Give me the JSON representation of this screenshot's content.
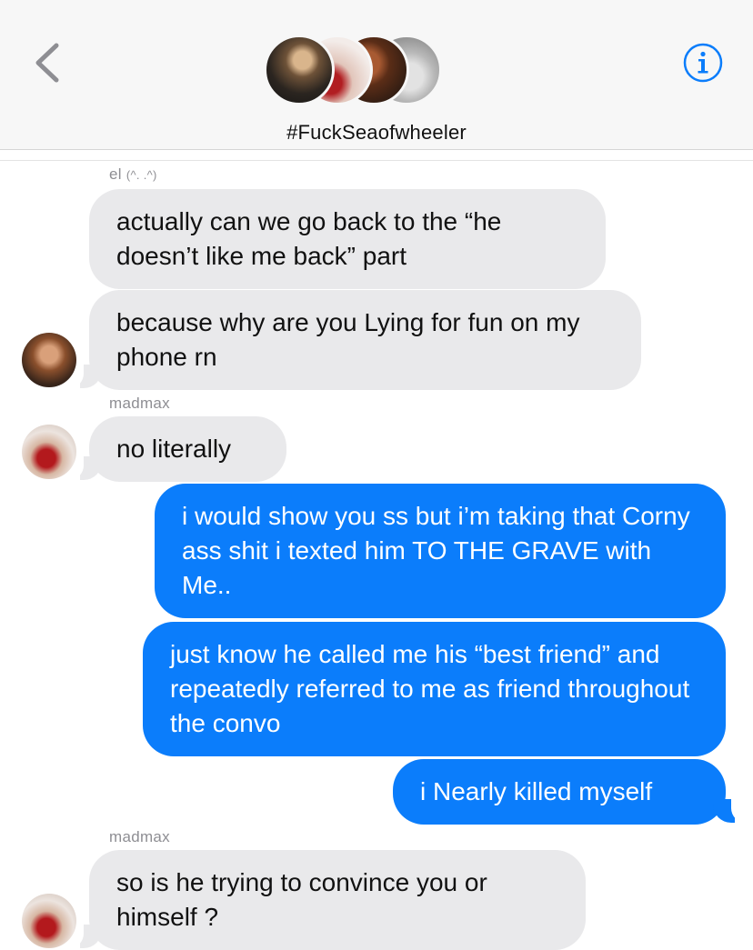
{
  "header": {
    "group_title": "#FuckSeaofwheeler",
    "back_icon": "chevron-left-icon",
    "info_icon": "info-icon",
    "accent_color": "#0b7dfb"
  },
  "messages": [
    {
      "sender": "el",
      "sender_emoticon": "(^. .^)",
      "text": "actually can we go back to the “he doesn’t like me back” part"
    },
    {
      "text": "because why are you Lying for fun on my phone rn"
    },
    {
      "sender": "madmax",
      "text": "no literally"
    },
    {
      "text": "i would show you ss but i’m taking that Corny ass shit i texted him TO THE GRAVE with Me.."
    },
    {
      "text": "just know he called me his “best friend” and repeatedly referred to me as friend throughout the convo"
    },
    {
      "text": "i Nearly killed myself"
    },
    {
      "sender": "madmax",
      "text": "so is he trying to convince you or himself ?"
    }
  ],
  "colors": {
    "incoming_bubble": "#e9e9eb",
    "outgoing_bubble": "#0b7dfb",
    "sender_label": "#8e8e93"
  }
}
